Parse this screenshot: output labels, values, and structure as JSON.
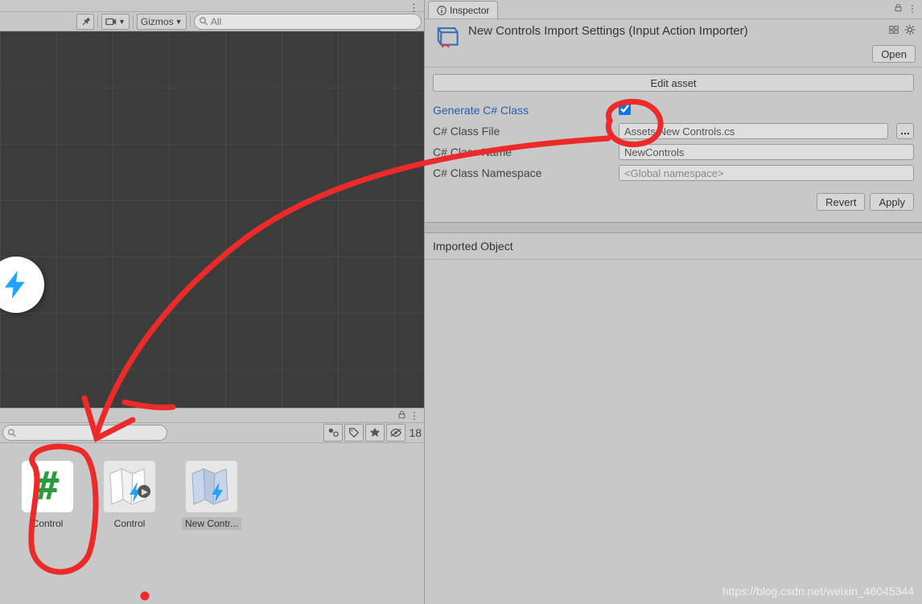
{
  "scene_toolbar": {
    "gizmos_label": "Gizmos",
    "search_placeholder": "All"
  },
  "project_bar": {
    "count": "18"
  },
  "assets": [
    {
      "label": "Control",
      "kind": "csharp"
    },
    {
      "label": "Control",
      "kind": "inputaction"
    },
    {
      "label": "New Contr...",
      "kind": "inputaction",
      "selected": true
    }
  ],
  "inspector": {
    "tab_label": "Inspector",
    "title": "New Controls Import Settings (Input Action Importer)",
    "open_label": "Open",
    "edit_asset_label": "Edit asset",
    "fields": {
      "generate_label": "Generate C# Class",
      "generate_checked": true,
      "class_file_label": "C# Class File",
      "class_file_value": "Assets/New Controls.cs",
      "class_name_label": "C# Class Name",
      "class_name_value": "NewControls",
      "class_ns_label": "C# Class Namespace",
      "class_ns_placeholder": "<Global namespace>"
    },
    "revert_label": "Revert",
    "apply_label": "Apply",
    "imported_label": "Imported Object"
  },
  "watermark": "https://blog.csdn.net/weixin_46045344"
}
